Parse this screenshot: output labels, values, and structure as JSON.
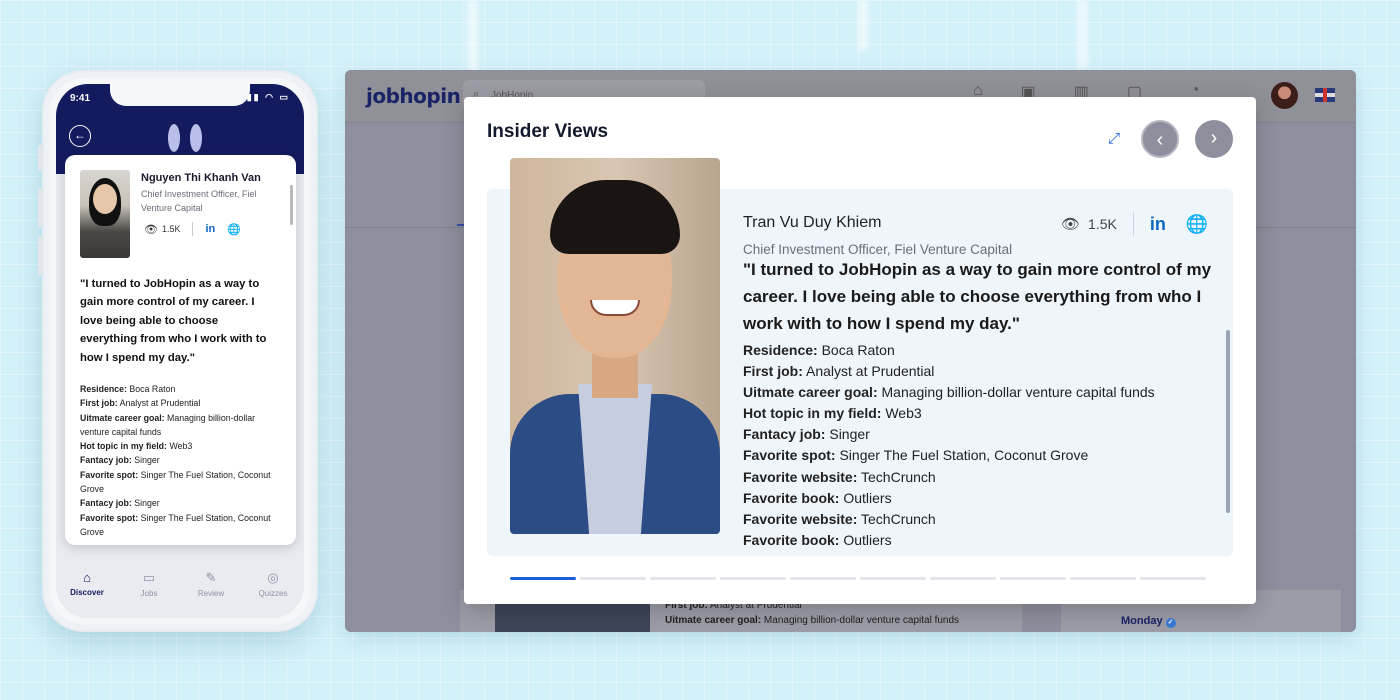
{
  "mobile": {
    "status_time": "9:41",
    "profile": {
      "name": "Nguyen Thi Khanh Van",
      "title": "Chief Investment Officer, Fiel Venture Capital",
      "views": "1.5K",
      "linkedin_label": "in",
      "quote": "\"I turned to JobHopin as a way to gain more control of my career. I love being able to choose everything from who I work with to how I spend my day.\"",
      "facts": [
        {
          "label": "Residence:",
          "value": " Boca Raton"
        },
        {
          "label": "First job:",
          "value": " Analyst at Prudential"
        },
        {
          "label": "Uitmate career goal:",
          "value": " Managing billion-dollar venture capital funds"
        },
        {
          "label": "Hot topic in my field:",
          "value": " Web3"
        },
        {
          "label": "Fantacy job:",
          "value": " Singer"
        },
        {
          "label": "Favorite spot:",
          "value": " Singer The Fuel Station, Coconut Grove"
        },
        {
          "label": "Fantacy job:",
          "value": " Singer"
        },
        {
          "label": "Favorite spot:",
          "value": " Singer The Fuel Station, Coconut Grove"
        }
      ]
    },
    "nav": [
      {
        "label": "Discover",
        "icon": "home-icon",
        "active": true
      },
      {
        "label": "Jobs",
        "icon": "jobs-icon",
        "active": false
      },
      {
        "label": "Review",
        "icon": "review-icon",
        "active": false
      },
      {
        "label": "Quizzes",
        "icon": "quiz-icon",
        "active": false
      }
    ]
  },
  "desktop": {
    "brand": "jobhopin",
    "search_value": "JobHopin",
    "background": {
      "facts": [
        {
          "label": "First job:",
          "value": " Analyst at Prudential"
        },
        {
          "label": "Uitmate career goal:",
          "value": " Managing billion-dollar venture capital funds"
        }
      ],
      "company": "Monday"
    }
  },
  "modal": {
    "title": "Insider Views",
    "profile": {
      "name": "Tran Vu Duy Khiem",
      "role": "Chief Investment Officer, Fiel Venture Capital",
      "views": "1.5K",
      "linkedin_label": "in",
      "quote": "\"I turned to JobHopin as a way to gain more control of my career. I love being able to choose everything from who I work with to how I spend my day.\"",
      "facts": [
        {
          "label": "Residence:",
          "value": " Boca Raton"
        },
        {
          "label": "First job:",
          "value": " Analyst at Prudential"
        },
        {
          "label": "Uitmate career goal:",
          "value": " Managing billion-dollar venture capital funds"
        },
        {
          "label": "Hot topic in my field:",
          "value": " Web3"
        },
        {
          "label": "Fantacy job:",
          "value": " Singer"
        },
        {
          "label": "Favorite spot:",
          "value": " Singer The Fuel Station, Coconut Grove"
        },
        {
          "label": "Favorite website:",
          "value": " TechCrunch"
        },
        {
          "label": "Favorite book:",
          "value": " Outliers"
        },
        {
          "label": "Favorite website:",
          "value": " TechCrunch"
        },
        {
          "label": "Favorite book:",
          "value": " Outliers"
        }
      ]
    },
    "carousel": {
      "count": 10,
      "active_index": 0
    }
  },
  "colors": {
    "accent": "#1e5fd6",
    "navy": "#141a5e",
    "linkedin": "#0a66c2"
  }
}
